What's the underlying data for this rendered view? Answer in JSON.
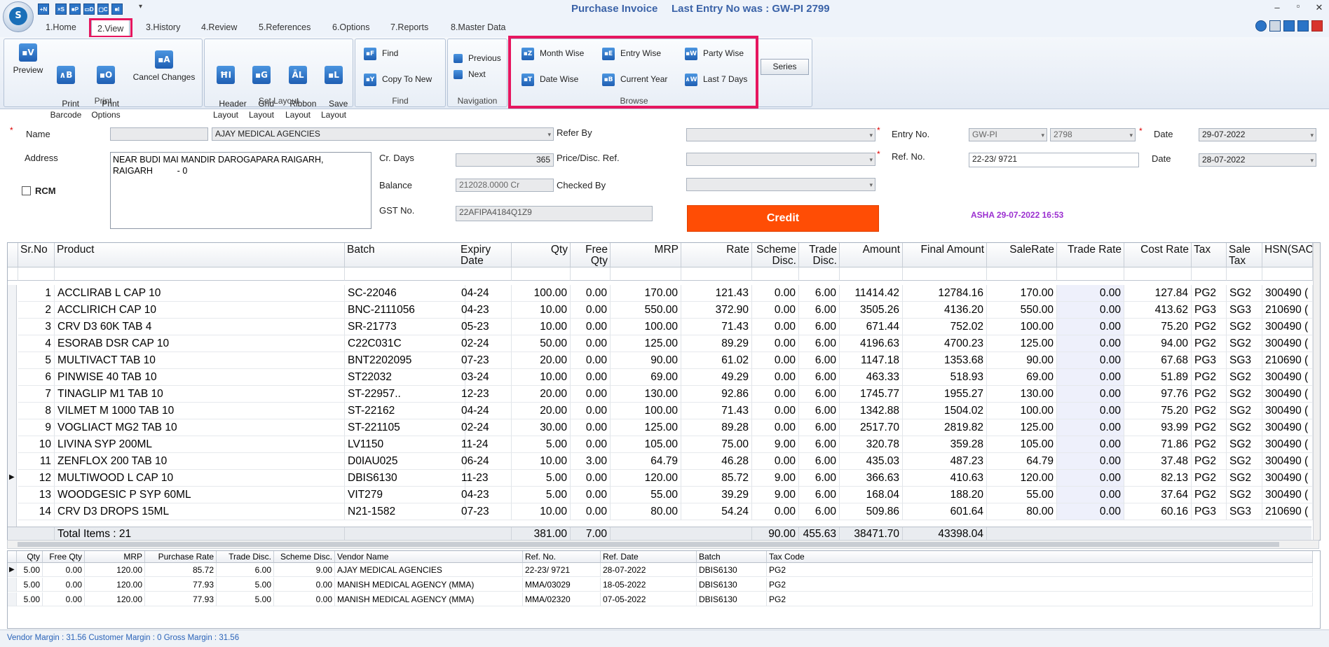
{
  "window": {
    "title": "Purchase Invoice",
    "last_entry": "Last Entry No was : GW-PI 2799",
    "quick_access": [
      "+N",
      "×S",
      "■P",
      "▭D",
      "▢C",
      "■I"
    ]
  },
  "menu": {
    "tabs": [
      "1.Home",
      "2.View",
      "3.History",
      "4.Review",
      "5.References",
      "6.Options",
      "7.Reports",
      "8.Master Data"
    ],
    "active": "2.View"
  },
  "ribbon": {
    "print": {
      "label": "Print",
      "buttons": [
        {
          "icon": "▪V",
          "label": "Preview"
        },
        {
          "icon": "∧B",
          "label": "Print\nBarcode"
        },
        {
          "icon": "▪O",
          "label": "Print\nOptions"
        },
        {
          "icon": "▪A",
          "label": "Cancel Changes"
        }
      ]
    },
    "set_layout": {
      "label": "Set Layout",
      "buttons": [
        {
          "icon": "ĦI",
          "label": "Header\nLayout"
        },
        {
          "icon": "▪G",
          "label": "Grid\nLayout"
        },
        {
          "icon": "ĀL",
          "label": "Ribbon\nLayout"
        },
        {
          "icon": "▪L",
          "label": "Save\nLayout"
        }
      ]
    },
    "find": {
      "label": "Find",
      "find": {
        "icon": "▪F",
        "label": "Find"
      },
      "copy": {
        "icon": "▪Y",
        "label": "Copy To New"
      }
    },
    "navigation": {
      "label": "Navigation",
      "previous": "Previous",
      "next": "Next"
    },
    "browse": {
      "label": "Browse",
      "buttons": [
        {
          "icon": "▪Z",
          "label": "Month Wise"
        },
        {
          "icon": "▪E",
          "label": "Entry Wise"
        },
        {
          "icon": "▪W",
          "label": "Party Wise"
        },
        {
          "icon": "▪T",
          "label": "Date Wise"
        },
        {
          "icon": "▪B",
          "label": "Current Year"
        },
        {
          "icon": "∧W",
          "label": "Last 7 Days"
        }
      ]
    },
    "series": "Series"
  },
  "header": {
    "name_label": "Name",
    "name_code": "",
    "name_value": "AJAY MEDICAL AGENCIES",
    "address_label": "Address",
    "address_value": "NEAR BUDI MAI MANDIR DAROGAPARA RAIGARH,\nRAIGARH          - 0",
    "rcm_label": "RCM",
    "cr_days_label": "Cr. Days",
    "cr_days_value": "365",
    "balance_label": "Balance",
    "balance_value": "212028.0000 Cr",
    "gst_label": "GST No.",
    "gst_value": "22AFIPA4184Q1Z9",
    "refer_by_label": "Refer By",
    "refer_by_value": "",
    "price_ref_label": "Price/Disc. Ref.",
    "price_ref_value": "",
    "checked_by_label": "Checked By",
    "checked_by_value": "",
    "credit_label": "Credit",
    "entry_no_label": "Entry No.",
    "entry_series": "GW-PI",
    "entry_number": "2798",
    "ref_no_label": "Ref. No.",
    "ref_no_value": "22-23/ 9721",
    "date_label": "Date",
    "date_value": "29-07-2022",
    "ref_date_label": "Date",
    "ref_date_value": "28-07-2022",
    "user_stamp": "ASHA 29-07-2022 16:53"
  },
  "grid": {
    "columns": [
      "Sr.No",
      "Product",
      "Batch",
      "Expiry Date",
      "Qty",
      "Free Qty",
      "MRP",
      "Rate",
      "Scheme Disc.",
      "Trade Disc.",
      "Amount",
      "Final Amount",
      "SaleRate",
      "Trade Rate",
      "Cost Rate",
      "Tax",
      "Sale Tax",
      "HSN(SAC)"
    ],
    "rows": [
      [
        "1",
        "ACCLIRAB L CAP 10",
        "SC-22046",
        "04-24",
        "100.00",
        "0.00",
        "170.00",
        "121.43",
        "0.00",
        "6.00",
        "11414.42",
        "12784.16",
        "170.00",
        "0.00",
        "127.84",
        "PG2",
        "SG2",
        "300490 ("
      ],
      [
        "2",
        "ACCLIRICH CAP 10",
        "BNC-2111056",
        "04-23",
        "10.00",
        "0.00",
        "550.00",
        "372.90",
        "0.00",
        "6.00",
        "3505.26",
        "4136.20",
        "550.00",
        "0.00",
        "413.62",
        "PG3",
        "SG3",
        "210690 ("
      ],
      [
        "3",
        "CRV D3 60K TAB 4",
        "SR-21773",
        "05-23",
        "10.00",
        "0.00",
        "100.00",
        "71.43",
        "0.00",
        "6.00",
        "671.44",
        "752.02",
        "100.00",
        "0.00",
        "75.20",
        "PG2",
        "SG2",
        "300490 ("
      ],
      [
        "4",
        "ESORAB DSR CAP 10",
        "C22C031C",
        "02-24",
        "50.00",
        "0.00",
        "125.00",
        "89.29",
        "0.00",
        "6.00",
        "4196.63",
        "4700.23",
        "125.00",
        "0.00",
        "94.00",
        "PG2",
        "SG2",
        "300490 ("
      ],
      [
        "5",
        "MULTIVACT TAB 10",
        "BNT2202095",
        "07-23",
        "20.00",
        "0.00",
        "90.00",
        "61.02",
        "0.00",
        "6.00",
        "1147.18",
        "1353.68",
        "90.00",
        "0.00",
        "67.68",
        "PG3",
        "SG3",
        "210690 ("
      ],
      [
        "6",
        "PINWISE 40 TAB 10",
        "ST22032",
        "03-24",
        "10.00",
        "0.00",
        "69.00",
        "49.29",
        "0.00",
        "6.00",
        "463.33",
        "518.93",
        "69.00",
        "0.00",
        "51.89",
        "PG2",
        "SG2",
        "300490 ("
      ],
      [
        "7",
        "TINAGLIP M1 TAB 10",
        "ST-22957..",
        "12-23",
        "20.00",
        "0.00",
        "130.00",
        "92.86",
        "0.00",
        "6.00",
        "1745.77",
        "1955.27",
        "130.00",
        "0.00",
        "97.76",
        "PG2",
        "SG2",
        "300490 ("
      ],
      [
        "8",
        "VILMET M 1000 TAB 10",
        "ST-22162",
        "04-24",
        "20.00",
        "0.00",
        "100.00",
        "71.43",
        "0.00",
        "6.00",
        "1342.88",
        "1504.02",
        "100.00",
        "0.00",
        "75.20",
        "PG2",
        "SG2",
        "300490 ("
      ],
      [
        "9",
        "VOGLIACT MG2 TAB 10",
        "ST-221105",
        "02-24",
        "30.00",
        "0.00",
        "125.00",
        "89.28",
        "0.00",
        "6.00",
        "2517.70",
        "2819.82",
        "125.00",
        "0.00",
        "93.99",
        "PG2",
        "SG2",
        "300490 ("
      ],
      [
        "10",
        "LIVINA SYP 200ML",
        "LV1150",
        "11-24",
        "5.00",
        "0.00",
        "105.00",
        "75.00",
        "9.00",
        "6.00",
        "320.78",
        "359.28",
        "105.00",
        "0.00",
        "71.86",
        "PG2",
        "SG2",
        "300490 ("
      ],
      [
        "11",
        "ZENFLOX 200 TAB 10",
        "D0IAU025",
        "06-24",
        "10.00",
        "3.00",
        "64.79",
        "46.28",
        "0.00",
        "6.00",
        "435.03",
        "487.23",
        "64.79",
        "0.00",
        "37.48",
        "PG2",
        "SG2",
        "300490 ("
      ],
      [
        "12",
        "MULTIWOOD L CAP 10",
        "DBIS6130",
        "11-23",
        "5.00",
        "0.00",
        "120.00",
        "85.72",
        "9.00",
        "6.00",
        "366.63",
        "410.63",
        "120.00",
        "0.00",
        "82.13",
        "PG2",
        "SG2",
        "300490 ("
      ],
      [
        "13",
        "WOODGESIC P SYP 60ML",
        "VIT279",
        "04-23",
        "5.00",
        "0.00",
        "55.00",
        "39.29",
        "9.00",
        "6.00",
        "168.04",
        "188.20",
        "55.00",
        "0.00",
        "37.64",
        "PG2",
        "SG2",
        "300490 ("
      ],
      [
        "14",
        "CRV D3 DROPS 15ML",
        "N21-1582",
        "07-23",
        "10.00",
        "0.00",
        "80.00",
        "54.24",
        "0.00",
        "6.00",
        "509.86",
        "601.64",
        "80.00",
        "0.00",
        "60.16",
        "PG3",
        "SG3",
        "210690 ("
      ]
    ],
    "selected_row_index": 11,
    "totals": {
      "label": "Total Items : 21",
      "qty": "381.00",
      "free_qty": "7.00",
      "scheme_disc": "90.00",
      "trade_disc": "455.63",
      "amount": "38471.70",
      "final_amount": "43398.04"
    }
  },
  "history": {
    "columns": [
      "Qty",
      "Free Qty",
      "MRP",
      "Purchase Rate",
      "Trade Disc.",
      "Scheme Disc.",
      "Vendor Name",
      "Ref. No.",
      "Ref. Date",
      "Batch",
      "Tax Code"
    ],
    "rows": [
      [
        "5.00",
        "0.00",
        "120.00",
        "85.72",
        "6.00",
        "9.00",
        "AJAY MEDICAL AGENCIES",
        "22-23/ 9721",
        "28-07-2022",
        "DBIS6130",
        "PG2"
      ],
      [
        "5.00",
        "0.00",
        "120.00",
        "77.93",
        "5.00",
        "0.00",
        "MANISH MEDICAL AGENCY     (MMA)",
        "MMA/03029",
        "18-05-2022",
        "DBIS6130",
        "PG2"
      ],
      [
        "5.00",
        "0.00",
        "120.00",
        "77.93",
        "5.00",
        "0.00",
        "MANISH MEDICAL AGENCY     (MMA)",
        "MMA/02320",
        "07-05-2022",
        "DBIS6130",
        "PG2"
      ]
    ]
  },
  "status": {
    "text": "Vendor Margin : 31.56 Customer Margin : 0 Gross Margin : 31.56"
  },
  "colors": {
    "highlight": "#e6165f",
    "credit": "#ff4d05",
    "title": "#3b63a8",
    "stamp": "#9b2fd0",
    "status_text": "#2a63b8"
  }
}
